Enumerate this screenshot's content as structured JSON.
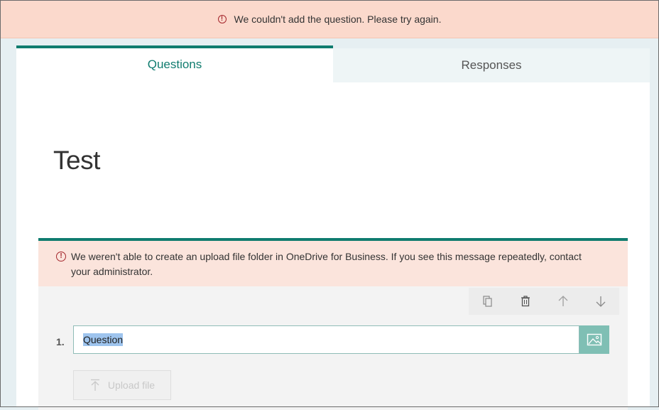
{
  "banner": {
    "error_message": "We couldn't add the question. Please try again.",
    "icon": "error-circle-icon",
    "color": "#fbd9cc"
  },
  "tabs": [
    {
      "label": "Questions",
      "active": true
    },
    {
      "label": "Responses",
      "active": false
    }
  ],
  "form": {
    "title": "Test"
  },
  "question": {
    "error_line1": "We weren't able to create an upload file folder in OneDrive for Business. If you see this message repeatedly, contact",
    "error_line2": "your administrator.",
    "number": "1.",
    "value": "Question",
    "upload_label": "Upload file",
    "toolbar": [
      "copy-icon",
      "delete-icon",
      "move-up-icon",
      "move-down-icon"
    ]
  },
  "colors": {
    "accent": "#107c6f",
    "error_bg": "#fbe4dc",
    "image_button": "#7fbfb4"
  }
}
